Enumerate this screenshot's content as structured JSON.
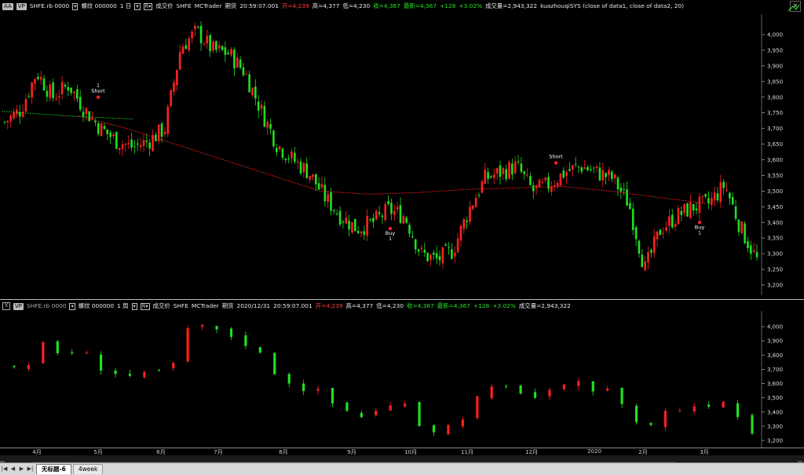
{
  "pane1": {
    "header": {
      "btn_aa": "AA",
      "btn_vp": "VP",
      "symbol": "SHFE.rb 0000",
      "name": "螺纹 000000",
      "interval": "1 日",
      "plot": "成交价",
      "exchange": "SHFE",
      "datasource": "MCTrader",
      "type": "期货",
      "time": "20:59:07.001",
      "open": "开=4,239",
      "high": "高=4,377",
      "low": "低=4,230",
      "close": "收=4,367",
      "last": "最新=4,367",
      "change": "+128",
      "pct": "+3.02%",
      "volume": "成交量=2,943,322",
      "study": "kuazhouqiSYS (close of data1,  close of data2,  20)"
    },
    "yticks": [
      "4,000",
      "3,950",
      "3,900",
      "3,850",
      "3,800",
      "3,750",
      "3,700",
      "3,650",
      "3,600",
      "3,550",
      "3,500",
      "3,450",
      "3,400",
      "3,350",
      "3,300",
      "3,250",
      "3,200"
    ],
    "signals": [
      {
        "label": "Short",
        "qty": "1"
      },
      {
        "label": "Buy",
        "qty": "1"
      },
      {
        "label": "Short",
        "qty": ""
      },
      {
        "label": "Buy",
        "qty": "1"
      }
    ]
  },
  "pane2": {
    "header": {
      "btn_x": "X",
      "btn_vp": "VP",
      "symbol": "SHFE.rb 0000",
      "name": "螺纹 000000",
      "interval": "1 周",
      "plot": "成交价",
      "exchange": "SHFE",
      "datasource": "MCTrader",
      "type": "期货",
      "date": "2020/12/31",
      "time": "20:59:07.001",
      "open": "开=4,239",
      "high": "高=4,377",
      "low": "低=4,230",
      "close": "收=4,367",
      "last": "最新=4,367",
      "change": "+128",
      "pct": "+3.02%",
      "volume": "成交量=2,943,322"
    },
    "yticks": [
      "4,000",
      "3,900",
      "3,800",
      "3,700",
      "3,600",
      "3,500",
      "3,400",
      "3,300",
      "3,200"
    ]
  },
  "xaxis": {
    "labels": [
      "4月",
      "5月",
      "6月",
      "7月",
      "8月",
      "9月",
      "10月",
      "11月",
      "12月",
      "2020",
      "2月",
      "3月"
    ]
  },
  "tabs": {
    "active": "无标题-6",
    "inactive": "4week"
  },
  "colors": {
    "up": "#ff2020",
    "down": "#20e020",
    "signal": "#ff2020",
    "line_green": "#20d020",
    "line_red": "#ff2020"
  },
  "chart_data": [
    {
      "type": "candlestick",
      "title": "",
      "interval": "1 日",
      "ylim": [
        3180,
        4030
      ],
      "x": [
        "4月",
        "5月",
        "6月",
        "7月",
        "8月",
        "9月",
        "10月",
        "11月",
        "12月",
        "2020",
        "2月",
        "3月"
      ],
      "close_trace": [
        3720,
        3760,
        3880,
        3800,
        3840,
        3760,
        3700,
        3660,
        3640,
        3660,
        3700,
        3960,
        4010,
        3950,
        3940,
        3880,
        3760,
        3650,
        3600,
        3560,
        3480,
        3420,
        3380,
        3400,
        3440,
        3420,
        3300,
        3280,
        3310,
        3440,
        3540,
        3560,
        3580,
        3500,
        3520,
        3560,
        3580,
        3560,
        3540,
        3460,
        3250,
        3380,
        3420,
        3450,
        3460,
        3520,
        3380,
        3280
      ],
      "series": [
        {
          "name": "green dotted",
          "values": [
            3755,
            3740,
            3730
          ]
        },
        {
          "name": "red dotted",
          "values": [
            3740,
            3700,
            3650,
            3600,
            3550,
            3500,
            3490,
            3495,
            3505,
            3510,
            3515,
            3500,
            3480,
            3460
          ]
        }
      ]
    },
    {
      "type": "candlestick",
      "title": "",
      "interval": "1 周",
      "ylim": [
        3180,
        4060
      ]
    }
  ]
}
